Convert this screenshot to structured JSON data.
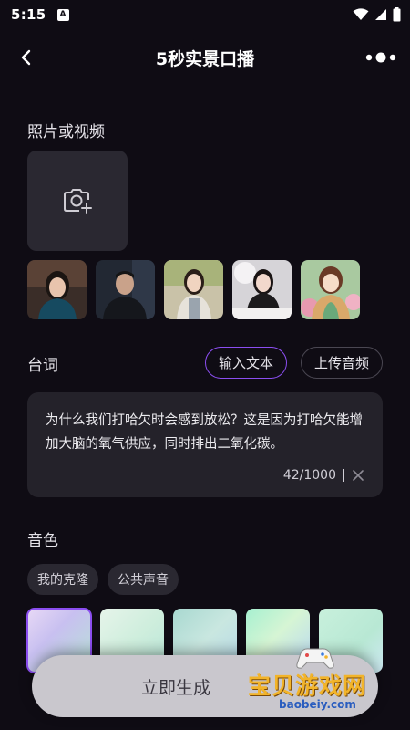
{
  "status_bar": {
    "time": "5:15",
    "notification_letter": "A"
  },
  "header": {
    "title": "5秒实景口播"
  },
  "media_section": {
    "label": "照片或视频"
  },
  "script_section": {
    "label": "台词",
    "tabs": [
      {
        "label": "输入文本",
        "active": true
      },
      {
        "label": "上传音频",
        "active": false
      }
    ],
    "text": "为什么我们打哈欠时会感到放松？这是因为打哈欠能增加大脑的氧气供应，同时排出二氧化碳。",
    "counter": "42/1000"
  },
  "voice_section": {
    "label": "音色",
    "chips": [
      {
        "label": "我的克隆"
      },
      {
        "label": "公共声音"
      }
    ],
    "selected_swatch": 1
  },
  "generate_button": {
    "label": "立即生成"
  },
  "watermark": {
    "name": "宝贝游戏网",
    "url": "baobeiy.com"
  },
  "colors": {
    "background": "#0f0c14",
    "accent": "#8b4ef0",
    "card": "#24222a",
    "watermark": "#f2b42a"
  },
  "icons": [
    "back-arrow-icon",
    "more-menu-icon",
    "camera-plus-icon",
    "clear-icon",
    "wifi-icon",
    "signal-icon",
    "battery-icon"
  ]
}
